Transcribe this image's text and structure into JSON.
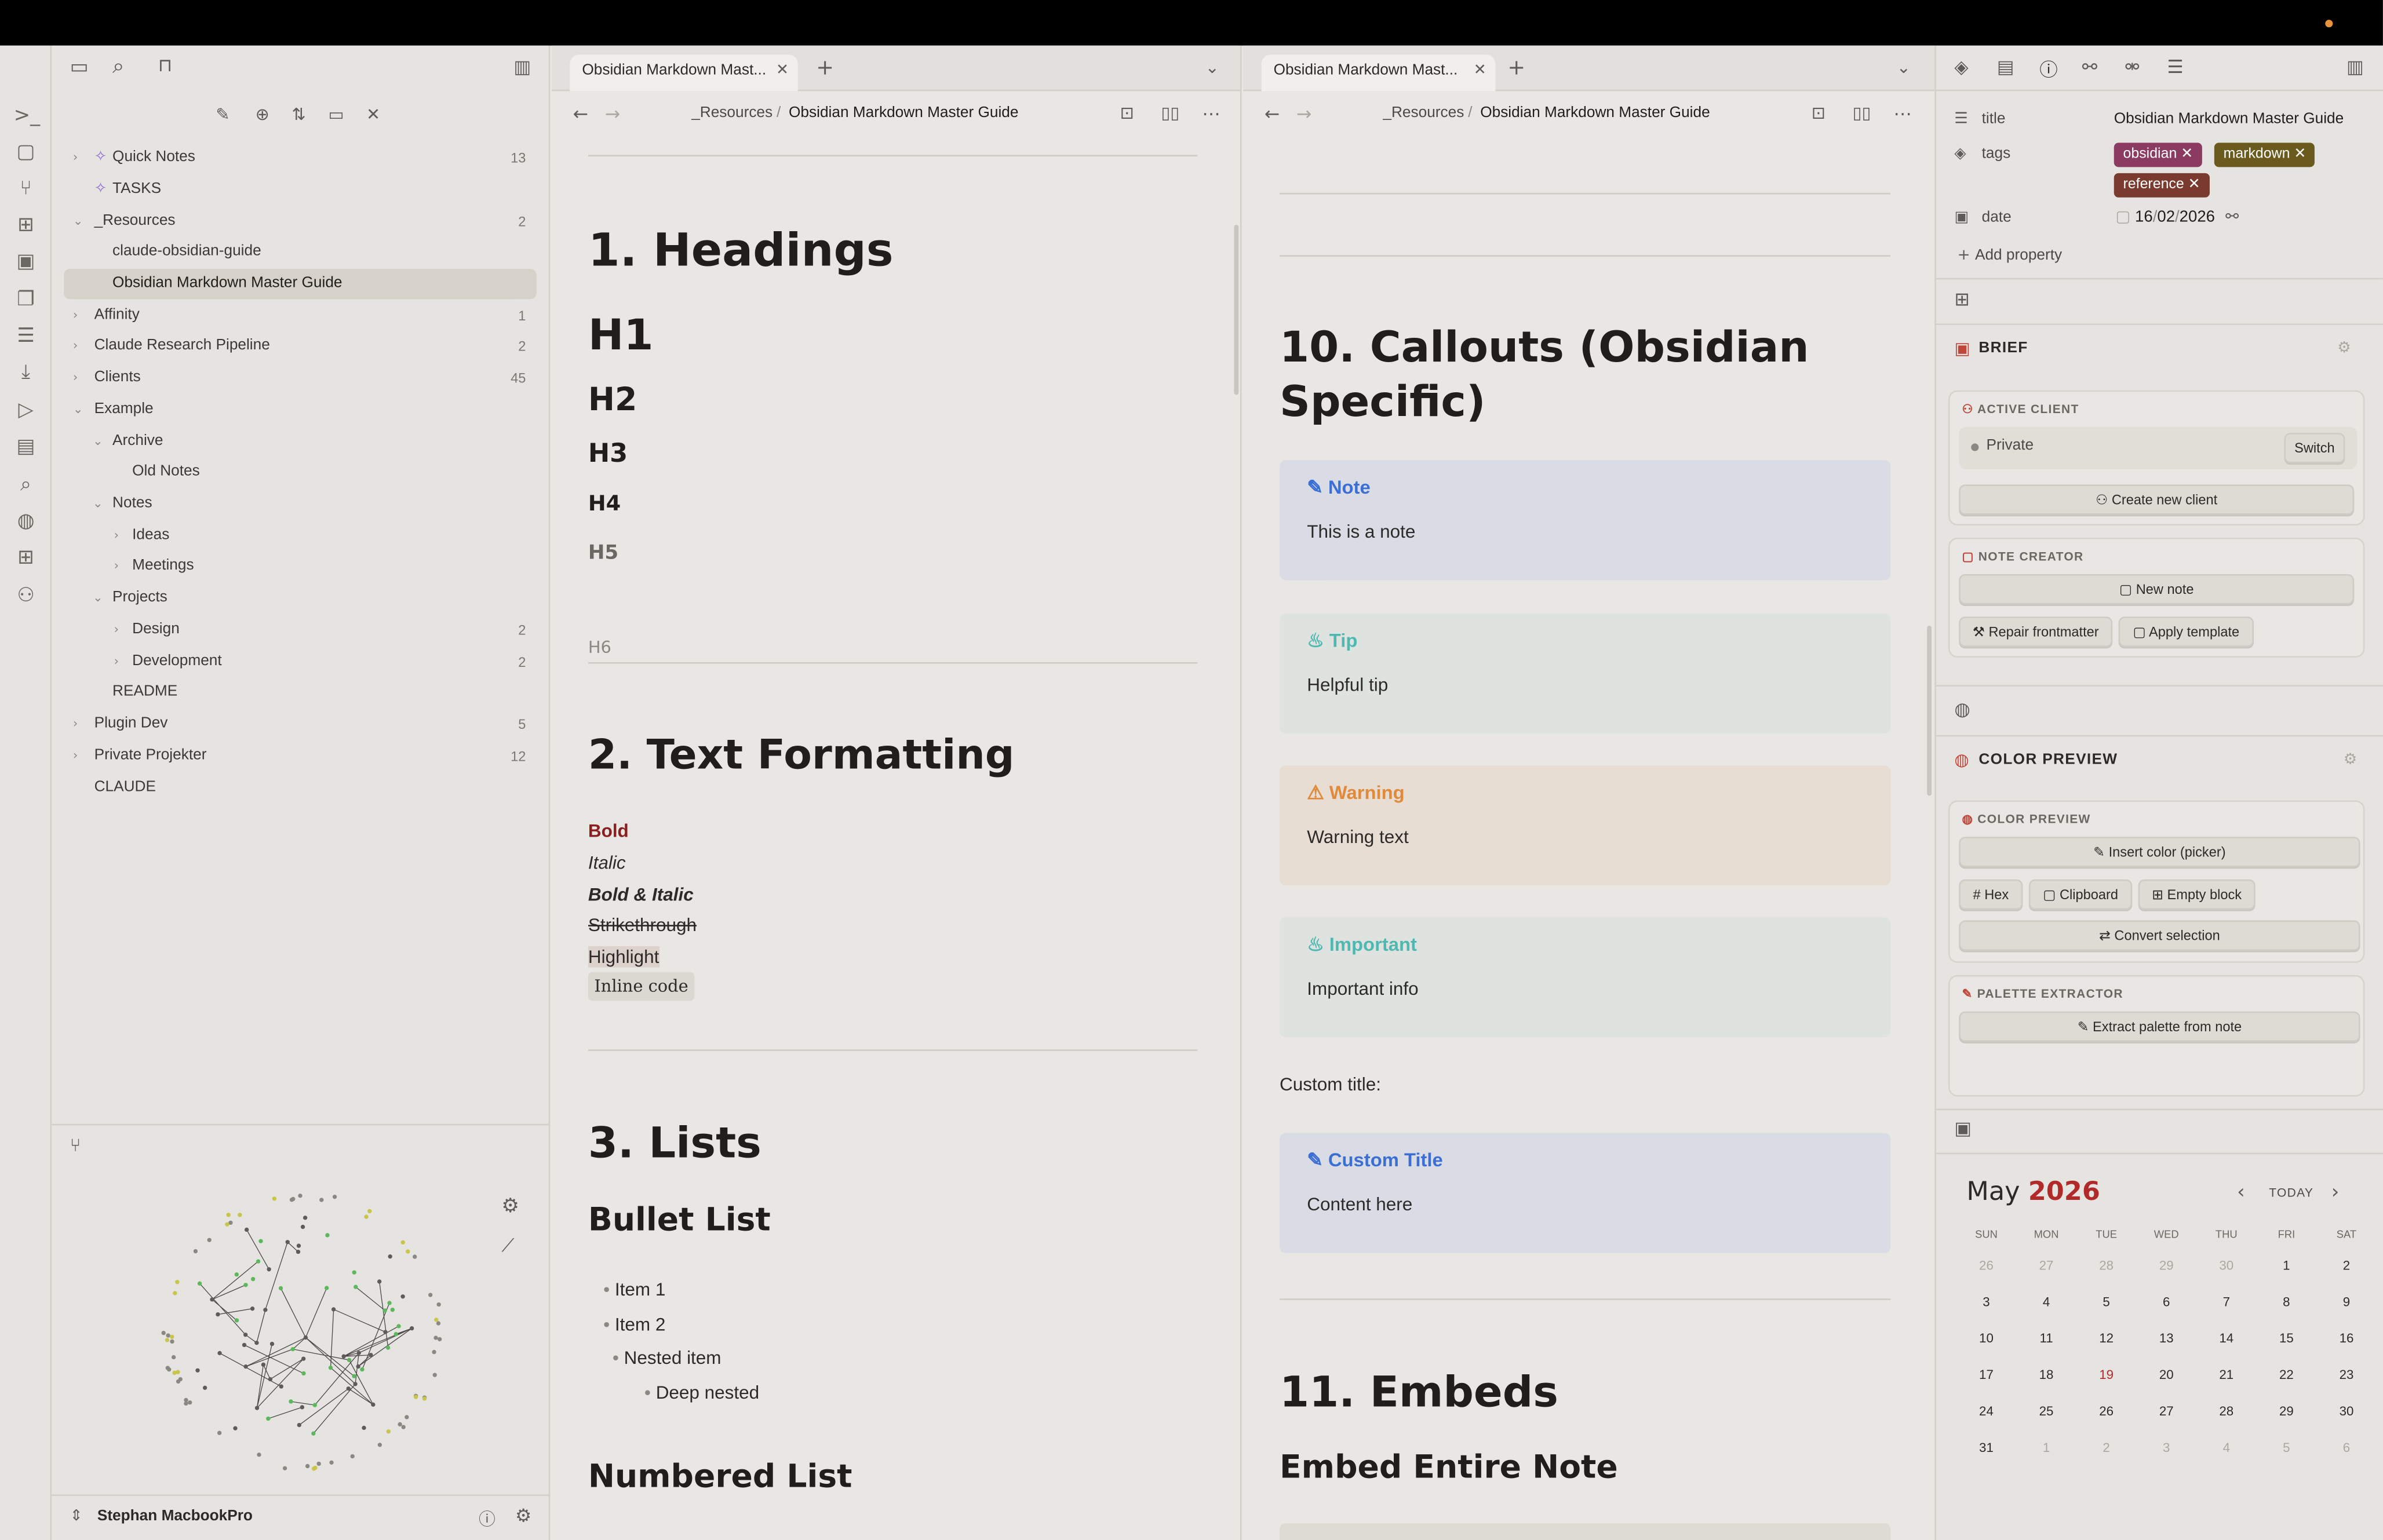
{
  "window": {
    "accent": "#e8923a"
  },
  "ribbon": {
    "icons": [
      "terminal-icon",
      "file-icon",
      "git-fork-icon",
      "grid-icon",
      "calendar-icon",
      "copy-icon",
      "list-icon",
      "download-icon",
      "play-icon",
      "file-text-icon",
      "search-icon",
      "palette-icon",
      "dashboard-icon",
      "users-icon"
    ]
  },
  "sidebar": {
    "items": [
      {
        "label": "Quick Notes",
        "count": "13"
      },
      {
        "label": "TASKS"
      },
      {
        "label": "_Resources",
        "count": "2"
      },
      {
        "label": "claude-obsidian-guide"
      },
      {
        "label": "Obsidian Markdown Master Guide"
      },
      {
        "label": "Affinity",
        "count": "1"
      },
      {
        "label": "Claude Research Pipeline",
        "count": "2"
      },
      {
        "label": "Clients",
        "count": "45"
      },
      {
        "label": "Example"
      },
      {
        "label": "Archive"
      },
      {
        "label": "Old Notes"
      },
      {
        "label": "Notes"
      },
      {
        "label": "Ideas"
      },
      {
        "label": "Meetings"
      },
      {
        "label": "Projects"
      },
      {
        "label": "Design",
        "count": "2"
      },
      {
        "label": "Development",
        "count": "2"
      },
      {
        "label": "README"
      },
      {
        "label": "Plugin Dev",
        "count": "5"
      },
      {
        "label": "Private Projekter",
        "count": "12"
      },
      {
        "label": "CLAUDE"
      }
    ],
    "vault_name": "Stephan MacbookPro"
  },
  "left_pane": {
    "tab_title": "Obsidian Markdown Mast...",
    "breadcrumb_parent": "_Resources",
    "breadcrumb_sep": "/",
    "breadcrumb_current": "Obsidian Markdown Master Guide",
    "headings": {
      "h1_section": "1. Headings",
      "h1": "H1",
      "h2": "H2",
      "h3": "H3",
      "h4": "H4",
      "h5": "H5",
      "h6": "H6"
    },
    "formatting": {
      "title": "2. Text Formatting",
      "bold": "Bold",
      "italic": "Italic",
      "bold_italic": "Bold & Italic",
      "strike": "Strikethrough",
      "highlight": "Highlight",
      "code": "Inline code"
    },
    "lists": {
      "title": "3. Lists",
      "bullet_title": "Bullet List",
      "item1": "Item 1",
      "item2": "Item 2",
      "nested": "Nested item",
      "deep": "Deep nested",
      "numbered_title": "Numbered List"
    }
  },
  "right_pane": {
    "tab_title": "Obsidian Markdown Mast...",
    "breadcrumb_parent": "_Resources",
    "breadcrumb_sep": "/",
    "breadcrumb_current": "Obsidian Markdown Master Guide",
    "callouts_title_line1": "10. Callouts (Obsidian",
    "callouts_title_line2": "Specific)",
    "callouts": [
      {
        "title": "Note",
        "body": "This is a note",
        "color": "#3b6fd4"
      },
      {
        "title": "Tip",
        "body": "Helpful tip",
        "color": "#4fb8b0"
      },
      {
        "title": "Warning",
        "body": "Warning text",
        "color": "#e08a3c"
      },
      {
        "title": "Important",
        "body": "Important info",
        "color": "#4fb8b0"
      }
    ],
    "custom_title_label": "Custom title:",
    "custom_callout": {
      "title": "Custom Title",
      "body": "Content here"
    },
    "embeds_title": "11. Embeds",
    "embed_entire": "Embed Entire Note"
  },
  "properties": {
    "title_key": "title",
    "title_val": "Obsidian Markdown Master Guide",
    "tags_key": "tags",
    "tags": [
      {
        "label": "obsidian",
        "color": "#8b3a62"
      },
      {
        "label": "markdown",
        "color": "#6b5a1e"
      },
      {
        "label": "reference",
        "color": "#7a3a2e"
      }
    ],
    "date_key": "date",
    "date_day": "16",
    "date_month": "02",
    "date_year": "2026",
    "add_property": "Add property"
  },
  "brief": {
    "title": "BRIEF",
    "active_client_label": "ACTIVE CLIENT",
    "client_value": "Private",
    "switch": "Switch",
    "create_client": "Create new client",
    "note_creator_label": "NOTE CREATOR",
    "new_note": "New note",
    "repair": "Repair frontmatter",
    "apply_template": "Apply template"
  },
  "color_preview": {
    "title": "COLOR PREVIEW",
    "sub": "COLOR PREVIEW",
    "insert": "Insert color (picker)",
    "hex": "Hex",
    "clipboard": "Clipboard",
    "empty": "Empty block",
    "convert": "Convert selection",
    "palette_label": "PALETTE EXTRACTOR",
    "extract": "Extract palette from note"
  },
  "calendar": {
    "month": "May",
    "year": "2026",
    "today": "TODAY",
    "weekdays": [
      "SUN",
      "MON",
      "TUE",
      "WED",
      "THU",
      "FRI",
      "SAT"
    ],
    "weeks": [
      [
        "26",
        "27",
        "28",
        "29",
        "30",
        "1",
        "2"
      ],
      [
        "3",
        "4",
        "5",
        "6",
        "7",
        "8",
        "9"
      ],
      [
        "10",
        "11",
        "12",
        "13",
        "14",
        "15",
        "16"
      ],
      [
        "17",
        "18",
        "19",
        "20",
        "21",
        "22",
        "23"
      ],
      [
        "24",
        "25",
        "26",
        "27",
        "28",
        "29",
        "30"
      ],
      [
        "31",
        "1",
        "2",
        "3",
        "4",
        "5",
        "6"
      ]
    ],
    "today_date": "19"
  }
}
